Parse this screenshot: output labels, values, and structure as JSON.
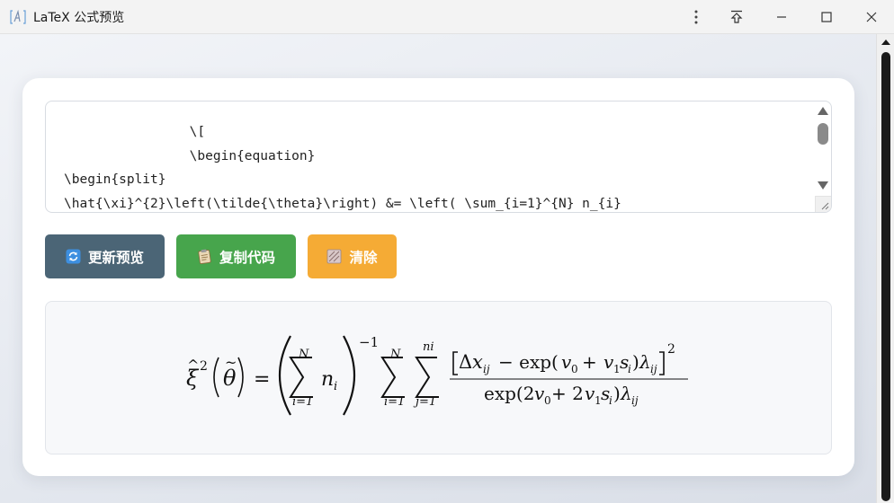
{
  "window": {
    "title": "LaTeX 公式预览"
  },
  "editor": {
    "lines": [
      "                \\[",
      "                \\begin{equation}",
      "\\begin{split}",
      "\\hat{\\xi}^{2}\\left(\\tilde{\\theta}\\right) &= \\left( \\sum_{i=1}^{N} n_{i}"
    ]
  },
  "toolbar": {
    "refresh_label": "更新预览",
    "copy_label": "复制代码",
    "clear_label": "清除",
    "refresh_icon": "refresh-icon",
    "copy_icon": "clipboard-icon",
    "clear_icon": "eraser-icon"
  },
  "colors": {
    "refresh_button": "#4b6576",
    "copy_button": "#47a54c",
    "clear_button": "#f5ab35"
  },
  "preview": {
    "xi": "ξ",
    "hat": "^",
    "sup2": "2",
    "theta": "θ",
    "tilde": "~",
    "equals": "=",
    "N": "N",
    "i_eq_1": "i=1",
    "j_eq_1": "j=1",
    "n": "n",
    "sub_i": "i",
    "minus_one": "−1",
    "ni": "ni",
    "numerator_delta": "Δ",
    "numerator_x": "x",
    "numerator_ij": "ij",
    "numerator_mid": "− exp(",
    "v0": "v",
    "zero": "0",
    "plus": "+",
    "v1": "v",
    "one": "1",
    "s": "s",
    "close_paren": ")",
    "lambda": "λ",
    "den_exp": "exp(2",
    "den_plus": " + 2"
  }
}
